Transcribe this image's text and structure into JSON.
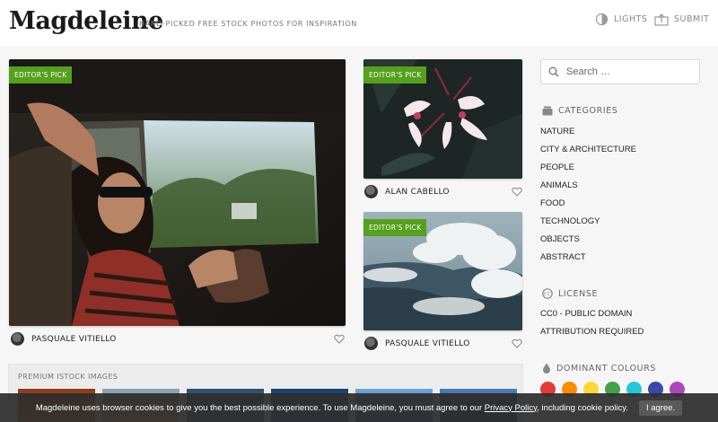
{
  "header": {
    "logo": "Magdeleine",
    "tagline": "HAND-PICKED FREE STOCK PHOTOS FOR INSPIRATION",
    "lights_label": "LIGHTS",
    "submit_label": "SUBMIT"
  },
  "photos": [
    {
      "badge": "EDITOR'S PICK",
      "author": "PASQUALE VITIELLO"
    },
    {
      "badge": "EDITOR'S PICK",
      "author": "ALAN CABELLO"
    },
    {
      "badge": "EDITOR'S PICK",
      "author": "PASQUALE VITIELLO"
    }
  ],
  "search": {
    "placeholder": "Search …"
  },
  "sidebar": {
    "categories_title": "CATEGORIES",
    "categories": [
      "NATURE",
      "CITY & ARCHITECTURE",
      "PEOPLE",
      "ANIMALS",
      "FOOD",
      "TECHNOLOGY",
      "OBJECTS",
      "ABSTRACT"
    ],
    "license_title": "LICENSE",
    "licenses": [
      "CC0 - PUBLIC DOMAIN",
      "ATTRIBUTION REQUIRED"
    ],
    "colours_title": "DOMINANT COLOURS",
    "colours": [
      "#e53935",
      "#fb8c00",
      "#fdd835",
      "#43a047",
      "#26c6da",
      "#3949ab",
      "#ab47bc"
    ]
  },
  "premium": {
    "title": "PREMIUM ISTOCK IMAGES"
  },
  "cookie": {
    "text_before": "Magdeleine uses browser cookies to give you the best possible experience. To use Magdeleine, you must agree to our ",
    "link": "Privacy Policy",
    "text_after": ", including cookie policy.",
    "button": "I agree."
  },
  "colors": {
    "accent": "#55a01c"
  }
}
